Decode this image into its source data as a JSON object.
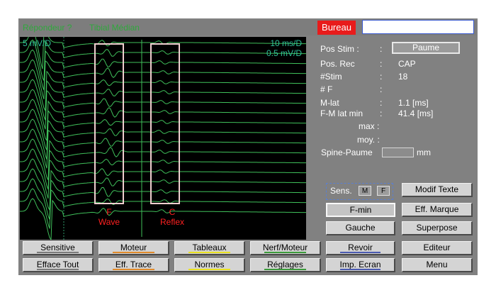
{
  "topbar": {
    "item1": "Répondeur ?",
    "item2": "Tibial Médian",
    "bureau_label": "Bureau",
    "bureau_value": ""
  },
  "scope": {
    "left_scale": "5 mV/D",
    "time_scale": "10 ms/D",
    "amp_scale": "0.5 mV/D",
    "f_label_line1": "F",
    "f_label_line2": "Wave",
    "c_label_line1": "C",
    "c_label_line2": "Reflex"
  },
  "info": {
    "pos_stim_label": "Pos Stim :",
    "pos_stim_colon": ":",
    "pos_stim_value": "Paume",
    "pos_rec_label": "Pos. Rec",
    "pos_rec_value": "CAP",
    "nstim_label": "#Stim",
    "nstim_value": "18",
    "nf_label": "# F",
    "nf_value": "",
    "mlat_label": "M-lat",
    "mlat_value": "1.1 [ms]",
    "fmlat_label": "F-M lat min",
    "fmlat_value": "41.4 [ms]",
    "max_label": "max :",
    "moy_label": "moy. :",
    "colon": ":",
    "spine_label": "Spine-Paume",
    "spine_value": "",
    "spine_unit": "mm"
  },
  "sens": {
    "label": "Sens.",
    "key_m": "M",
    "key_f": "F"
  },
  "buttons": {
    "modif_texte": "Modif Texte",
    "f_min": "F-min",
    "eff_marque": "Eff. Marque",
    "gauche": "Gauche",
    "superpose": "Superpose",
    "sensitive": "Sensitive",
    "moteur": "Moteur",
    "tableaux": "Tableaux",
    "nerf_moteur": "Nerf/Moteur",
    "revoir": "Revoir",
    "editeur": "Editeur",
    "efface_tout": "Efface Tout",
    "eff_trace": "Eff. Trace",
    "normes": "Normes",
    "reglages": "Réglages",
    "imp_ecran": "Imp. Ecran",
    "menu": "Menu"
  },
  "colors": {
    "trace_green": "#3fbf5a",
    "marker_box": "#f0d0d0",
    "bureau_red": "#e81b1b"
  },
  "trace_count": 18
}
